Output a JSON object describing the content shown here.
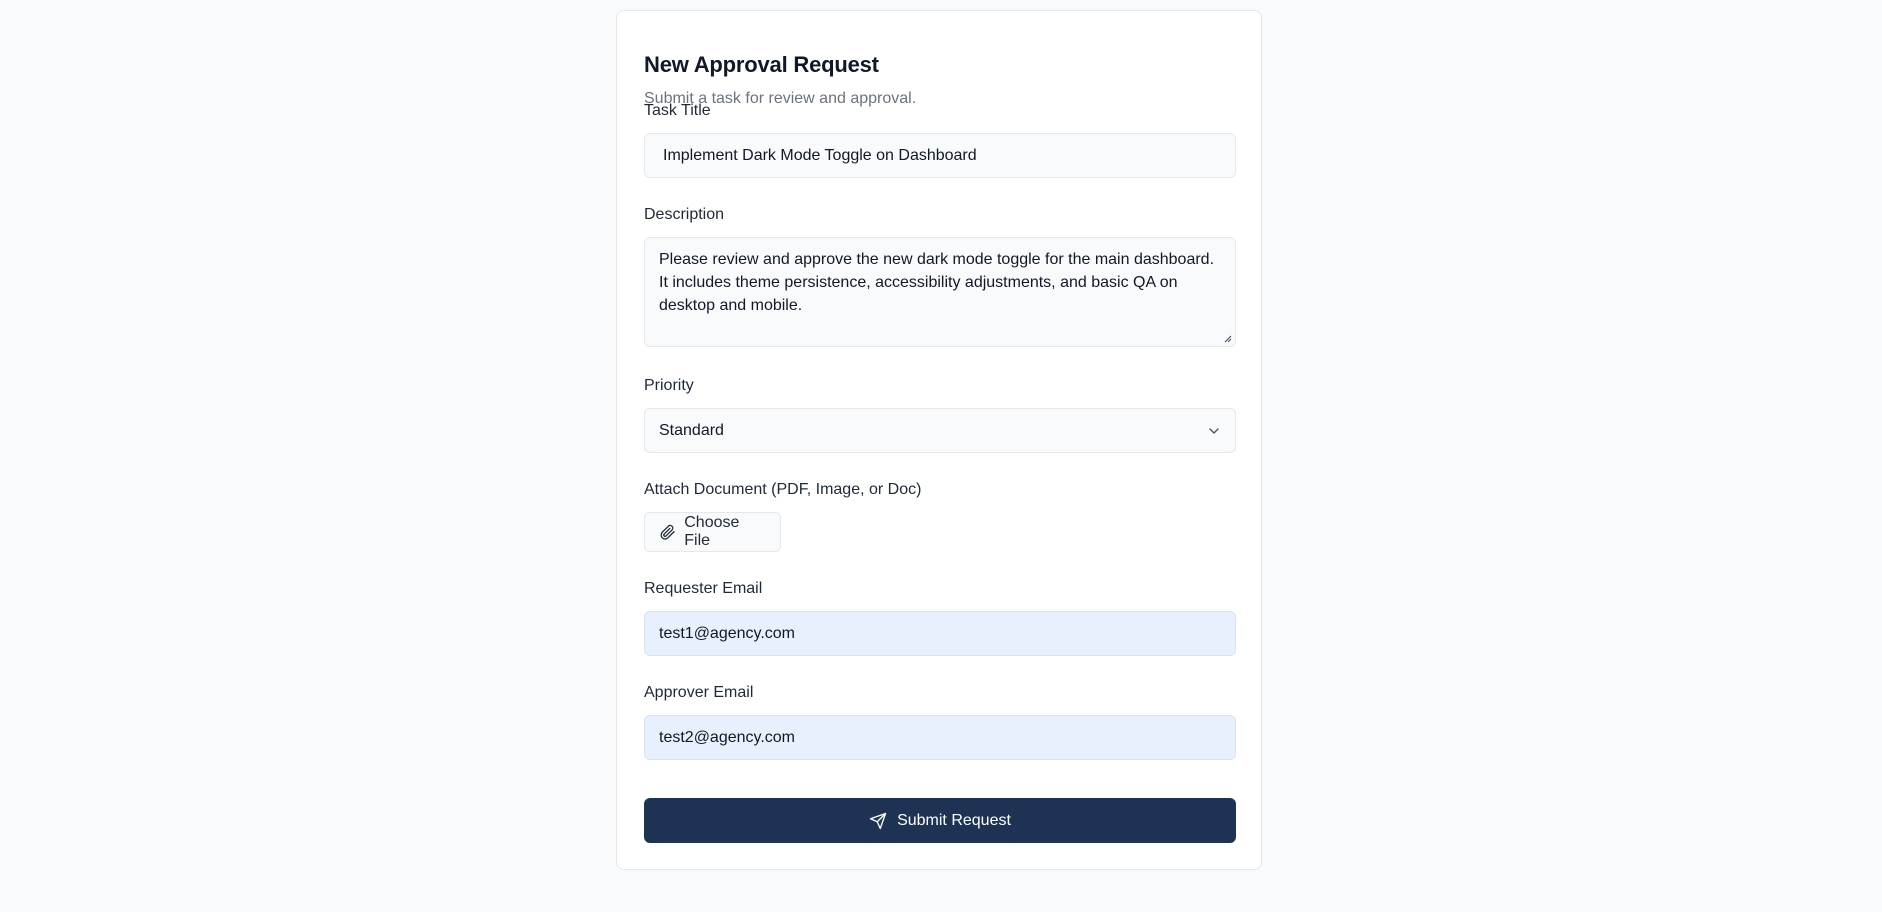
{
  "form": {
    "title": "New Approval Request",
    "subtitle": "Submit a task for review and approval.",
    "task_title": {
      "label": "Task Title",
      "value": "Implement Dark Mode Toggle on Dashboard"
    },
    "description": {
      "label": "Description",
      "value": "Please review and approve the new dark mode toggle for the main dashboard. It includes theme persistence, accessibility adjustments, and basic QA on desktop and mobile."
    },
    "priority": {
      "label": "Priority",
      "selected": "Standard",
      "icon": "chevron-down-icon"
    },
    "attachment": {
      "label": "Attach Document (PDF, Image, or Doc)",
      "button_label": "Choose File",
      "icon": "paperclip-icon"
    },
    "requester_email": {
      "label": "Requester Email",
      "value": "test1@agency.com"
    },
    "approver_email": {
      "label": "Approver Email",
      "value": "test2@agency.com"
    },
    "submit": {
      "label": "Submit Request",
      "icon": "send-icon"
    }
  },
  "colors": {
    "page_bg": "#f8fafc",
    "card_bg": "#ffffff",
    "input_bg": "#f8fafc",
    "autofill_bg": "#e8f0fe",
    "primary": "#1e3354",
    "muted_text": "#6b7280"
  }
}
